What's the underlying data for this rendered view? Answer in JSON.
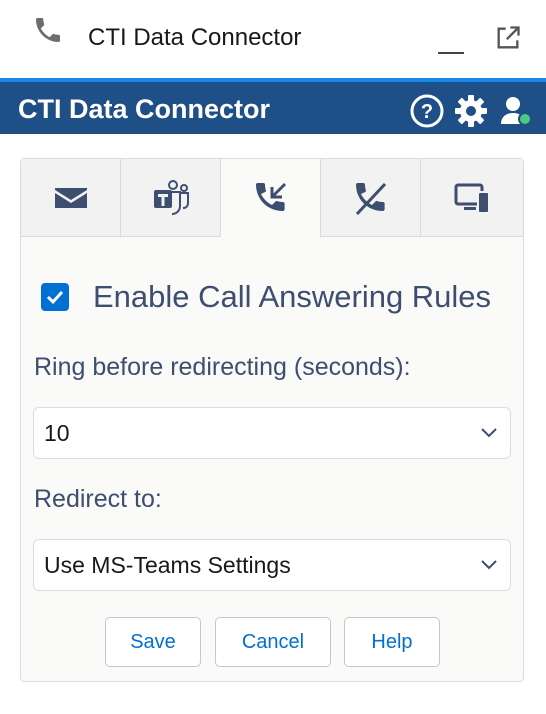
{
  "utility_bar": {
    "title": "CTI Data Connector"
  },
  "header": {
    "title": "CTI Data Connector"
  },
  "tabs": [
    {
      "name": "email",
      "icon": "envelope-icon"
    },
    {
      "name": "teams",
      "icon": "ms-teams-icon"
    },
    {
      "name": "call-answering",
      "icon": "incoming-call-icon",
      "active": true
    },
    {
      "name": "missed-call",
      "icon": "missed-call-icon"
    },
    {
      "name": "devices",
      "icon": "devices-icon"
    }
  ],
  "call_answering": {
    "enable_label": "Enable Call Answering Rules",
    "enabled": true,
    "ring_label": "Ring before redirecting (seconds):",
    "ring_value": "10",
    "redirect_label": "Redirect to:",
    "redirect_value": "Use MS-Teams Settings"
  },
  "buttons": {
    "save": "Save",
    "cancel": "Cancel",
    "help": "Help"
  },
  "colors": {
    "header_bar": "#1e4f86",
    "accent_line": "#1589ee",
    "primary": "#0070d2",
    "status_green": "#4bca81"
  }
}
